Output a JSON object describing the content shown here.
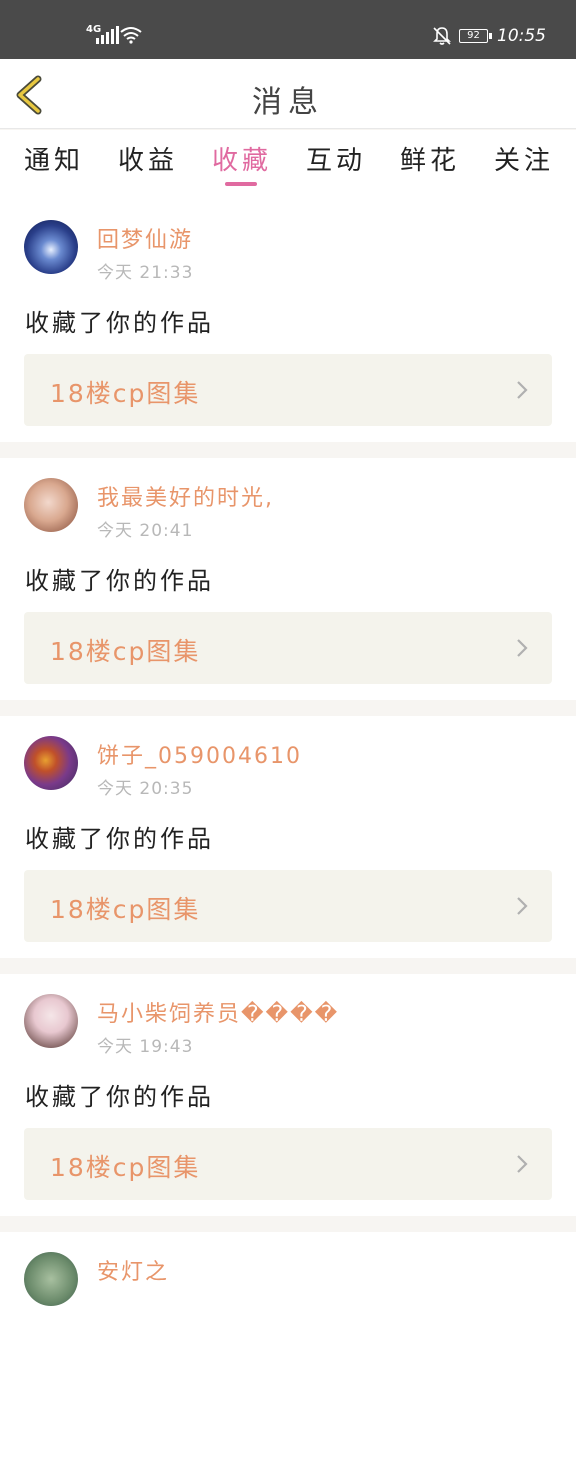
{
  "status_bar": {
    "network": "4G",
    "battery": "92",
    "time": "10:55"
  },
  "nav": {
    "title": "消息"
  },
  "tabs": [
    {
      "label": "通知",
      "active": false
    },
    {
      "label": "收益",
      "active": false
    },
    {
      "label": "收藏",
      "active": true
    },
    {
      "label": "互动",
      "active": false
    },
    {
      "label": "鲜花",
      "active": false
    },
    {
      "label": "关注",
      "active": false
    }
  ],
  "notifications": [
    {
      "username": "回梦仙游",
      "time": "今天 21:33",
      "action": "收藏了你的作品",
      "work_title": "18楼cp图集"
    },
    {
      "username": "我最美好的时光,",
      "time": "今天 20:41",
      "action": "收藏了你的作品",
      "work_title": "18楼cp图集"
    },
    {
      "username": "饼子_059004610",
      "time": "今天 20:35",
      "action": "收藏了你的作品",
      "work_title": "18楼cp图集"
    },
    {
      "username": "马小柴饲养员����",
      "time": "今天 19:43",
      "action": "收藏了你的作品",
      "work_title": "18楼cp图集"
    },
    {
      "username": "安灯之",
      "time": "",
      "action": "",
      "work_title": ""
    }
  ],
  "colors": {
    "accent_pink": "#e06aa0",
    "username_orange": "#e8956a",
    "back_arrow": "#e8c840"
  },
  "icons": {
    "back": "chevron-left-icon",
    "chevron": "chevron-right-icon",
    "bell": "bell-off-icon",
    "wifi": "wifi-icon",
    "signal": "signal-icon"
  }
}
